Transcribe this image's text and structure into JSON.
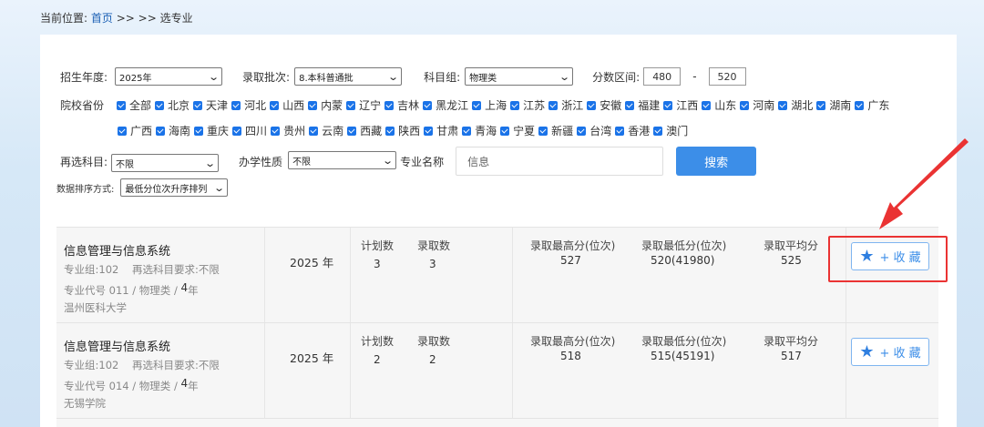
{
  "breadcrumb": {
    "prefix": "当前位置:",
    "home": "首页",
    "sep": ">> >>",
    "current": "选专业"
  },
  "filters": {
    "year_label": "招生年度:",
    "year_value": "2025年",
    "batch_label": "录取批次:",
    "batch_value": "8.本科普通批",
    "subject_label": "科目组:",
    "subject_value": "物理类",
    "score_label": "分数区间:",
    "score_min": "480",
    "score_dash": "-",
    "score_max": "520",
    "province_label": "院校省份",
    "provinces_row1": [
      "全部",
      "北京",
      "天津",
      "河北",
      "山西",
      "内蒙",
      "辽宁",
      "吉林",
      "黑龙江",
      "上海",
      "江苏",
      "浙江",
      "安徽",
      "福建",
      "江西",
      "山东",
      "河南",
      "湖北",
      "湖南",
      "广东"
    ],
    "provinces_row2": [
      "广西",
      "海南",
      "重庆",
      "四川",
      "贵州",
      "云南",
      "西藏",
      "陕西",
      "甘肃",
      "青海",
      "宁夏",
      "新疆",
      "台湾",
      "香港",
      "澳门"
    ],
    "reselect_label": "再选科目:",
    "reselect_value": "不限",
    "school_type_label": "办学性质",
    "school_type_value": "不限",
    "major_label": "专业名称",
    "major_value": "信息",
    "search_button": "搜索",
    "sort_label": "数据排序方式:",
    "sort_value": "最低分位次升序排列"
  },
  "columns": {
    "plan": "计划数",
    "admit": "录取数",
    "max": "录取最高分(位次)",
    "min": "录取最低分(位次)",
    "avg": "录取平均分"
  },
  "results": [
    {
      "name": "信息管理与信息系统",
      "group": "专业组:102",
      "req": "再选科目要求:不限",
      "code": "专业代号 011 / 物理类 /",
      "years_num": "4",
      "years_unit": "年",
      "school": "温州医科大学",
      "year_num": "2025",
      "year_unit": "年",
      "plan": "3",
      "admit": "3",
      "max": "527",
      "min": "520(41980)",
      "avg": "525",
      "fav_label": "+ 收 藏"
    },
    {
      "name": "信息管理与信息系统",
      "group": "专业组:102",
      "req": "再选科目要求:不限",
      "code": "专业代号 014 / 物理类 /",
      "years_num": "4",
      "years_unit": "年",
      "school": "无锡学院",
      "year_num": "2025",
      "year_unit": "年",
      "plan": "2",
      "admit": "2",
      "max": "518",
      "min": "515(45191)",
      "avg": "517",
      "fav_label": "+ 收 藏"
    }
  ],
  "colors": {
    "accent": "#3c8ee8",
    "highlight": "#ea3333",
    "checkbox": "#1a73e8"
  }
}
